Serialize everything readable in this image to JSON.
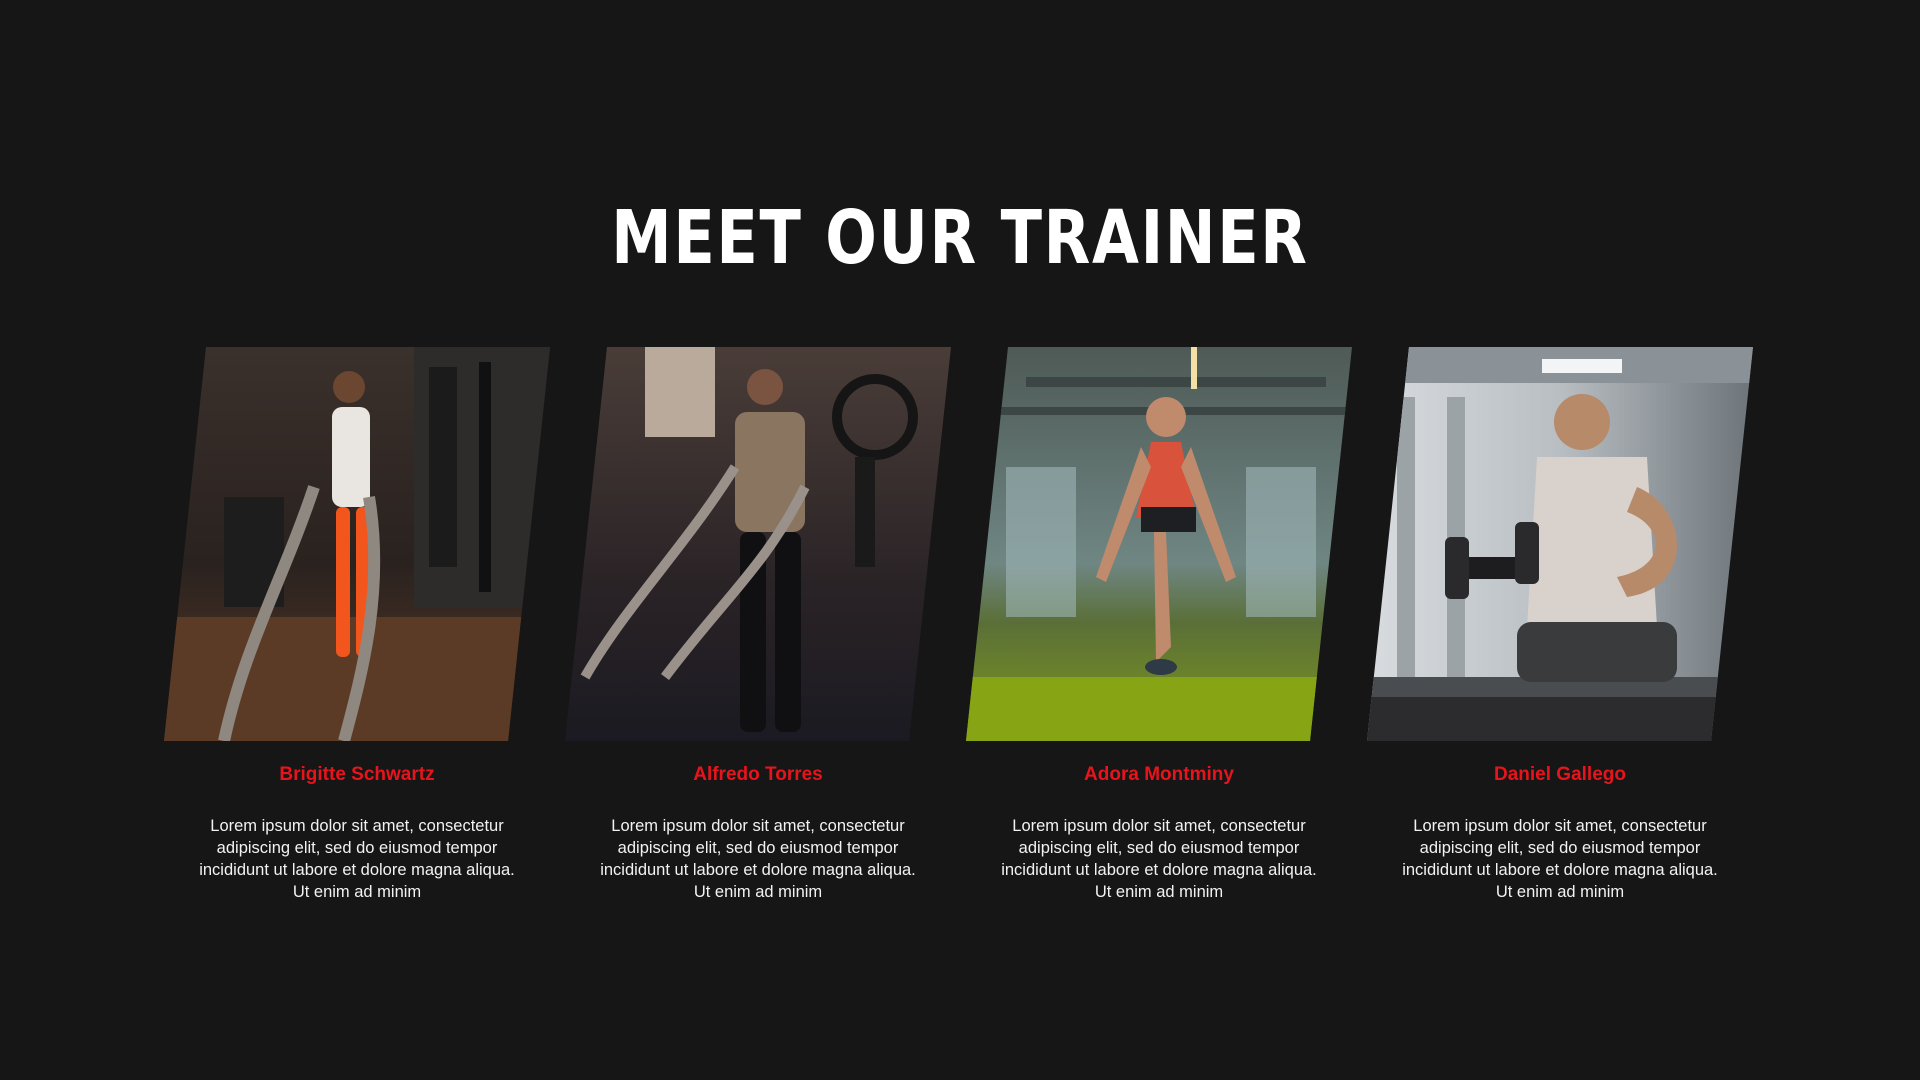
{
  "page": {
    "title": "MEET OUR TRAINER",
    "background_color": "#161616",
    "accent_color": "#e8141c"
  },
  "trainers": [
    {
      "name": "Brigitte Schwartz",
      "description": "Lorem ipsum dolor sit amet, consectetur adipiscing elit, sed do eiusmod tempor incididunt ut labore et dolore magna aliqua. Ut enim ad minim"
    },
    {
      "name": "Alfredo Torres",
      "description": "Lorem ipsum dolor sit amet, consectetur adipiscing elit, sed do eiusmod tempor incididunt ut labore et dolore magna aliqua. Ut enim ad minim"
    },
    {
      "name": "Adora Montminy",
      "description": "Lorem ipsum dolor sit amet, consectetur adipiscing elit, sed do eiusmod tempor incididunt ut labore et dolore magna aliqua. Ut enim ad minim"
    },
    {
      "name": "Daniel Gallego",
      "description": "Lorem ipsum dolor sit amet, consectetur adipiscing elit, sed do eiusmod tempor incididunt ut labore et dolore magna aliqua. Ut enim ad minim"
    }
  ]
}
